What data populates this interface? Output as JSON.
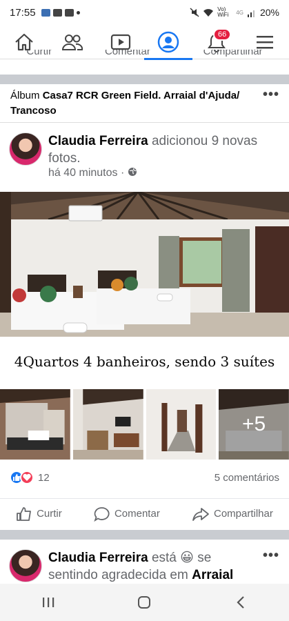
{
  "status_bar": {
    "time": "17:55",
    "battery": "20%",
    "network": "Vo) WiFi",
    "signal_label": "4G"
  },
  "nav": {
    "notifications_badge": "66",
    "active_tab": "profile",
    "icons": [
      "home-icon",
      "friends-icon",
      "watch-icon",
      "profile-icon",
      "notifications-icon",
      "menu-icon"
    ]
  },
  "prev_post_actions": [
    "Curtir",
    "Comentar",
    "Compartilhar"
  ],
  "album": {
    "prefix": "Álbum ",
    "name": "Casa7 RCR Green Field. Arraial d'Ajuda/ Trancoso"
  },
  "post": {
    "author": "Claudia Ferreira",
    "action_text": " adicionou 9 novas fotos.",
    "time": "há 40 minutos · ",
    "privacy_icon": "globe-icon",
    "caption": "4Quartos 4 banheiros,  sendo 3 suítes",
    "more_photos": "+5",
    "reaction_count": "12",
    "comments": "5 comentários",
    "actions": {
      "like": "Curtir",
      "comment": "Comentar",
      "share": "Compartilhar"
    }
  },
  "next_post": {
    "author": "Claudia Ferreira",
    "verb": " está ",
    "emoji": "😀",
    "feeling": " se sentindo agradecida em ",
    "place": "Arraial"
  },
  "colors": {
    "accent": "#1877f2",
    "badge": "#e41e3f",
    "divider": "#c9ccd1",
    "secondary_text": "#65676b"
  }
}
